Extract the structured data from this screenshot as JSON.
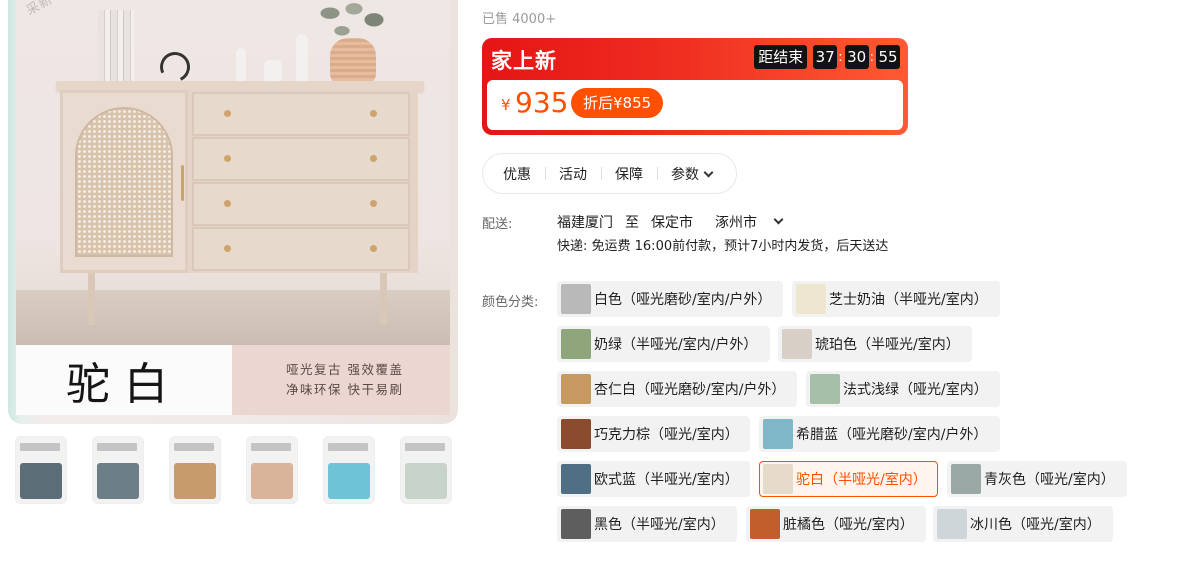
{
  "gallery": {
    "watermark": "采新 乐木漆 驿",
    "banner_title": "驼白",
    "banner_line1": "哑光复古 强效覆盖",
    "banner_line2": "净味环保 快干易刷",
    "thumbnails": [
      {
        "name": "thumb-1",
        "color": "#5b6e78"
      },
      {
        "name": "thumb-2",
        "color": "#6c7e86"
      },
      {
        "name": "thumb-3",
        "color": "#c79b6b"
      },
      {
        "name": "thumb-4",
        "color": "#d9b49a"
      },
      {
        "name": "thumb-5",
        "color": "#6fc3d6"
      },
      {
        "name": "thumb-6",
        "color": "#c8d4c9"
      }
    ]
  },
  "info": {
    "sold": "已售 4000+",
    "promo": {
      "title": "家上新",
      "countdown_label": "距结束",
      "hours": "37",
      "minutes": "30",
      "seconds": "55",
      "separator": ":",
      "currency": "¥",
      "price": "935",
      "after_label": "折后¥855"
    },
    "tabs": [
      "优惠",
      "活动",
      "保障",
      "参数"
    ],
    "shipping": {
      "label": "配送:",
      "from": "福建厦门",
      "to_word": "至",
      "to_city": "保定市",
      "to_district": "涿州市",
      "detail": "快递: 免运费  16:00前付款，预计7小时内发货，后天送达"
    },
    "colors": {
      "label": "颜色分类:",
      "options": [
        {
          "label": "白色（哑光磨砂/室内/户外）",
          "swatch": "#b9b9b9",
          "selected": false
        },
        {
          "label": "芝士奶油（半哑光/室内）",
          "swatch": "#efe6cf",
          "selected": false
        },
        {
          "label": "奶绿（半哑光/室内/户外）",
          "swatch": "#8fa57c",
          "selected": false
        },
        {
          "label": "琥珀色（半哑光/室内）",
          "swatch": "#d8cfc6",
          "selected": false
        },
        {
          "label": "杏仁白（哑光磨砂/室内/户外）",
          "swatch": "#c79a63",
          "selected": false
        },
        {
          "label": "法式浅绿（哑光/室内）",
          "swatch": "#a6bfa9",
          "selected": false
        },
        {
          "label": "巧克力棕（哑光/室内）",
          "swatch": "#8a4b2f",
          "selected": false
        },
        {
          "label": "希腊蓝（哑光磨砂/室内/户外）",
          "swatch": "#7fb7c9",
          "selected": false
        },
        {
          "label": "欧式蓝（半哑光/室内）",
          "swatch": "#4f6f85",
          "selected": false
        },
        {
          "label": "驼白（半哑光/室内）",
          "swatch": "#e6dacb",
          "selected": true
        },
        {
          "label": "青灰色（哑光/室内）",
          "swatch": "#9aa8a6",
          "selected": false
        },
        {
          "label": "黑色（半哑光/室内）",
          "swatch": "#5e5e5e",
          "selected": false
        },
        {
          "label": "脏橘色（哑光/室内）",
          "swatch": "#c25d2c",
          "selected": false
        },
        {
          "label": "冰川色（哑光/室内）",
          "swatch": "#cfd6d9",
          "selected": false
        }
      ]
    },
    "accent_color": "#ff5000"
  }
}
